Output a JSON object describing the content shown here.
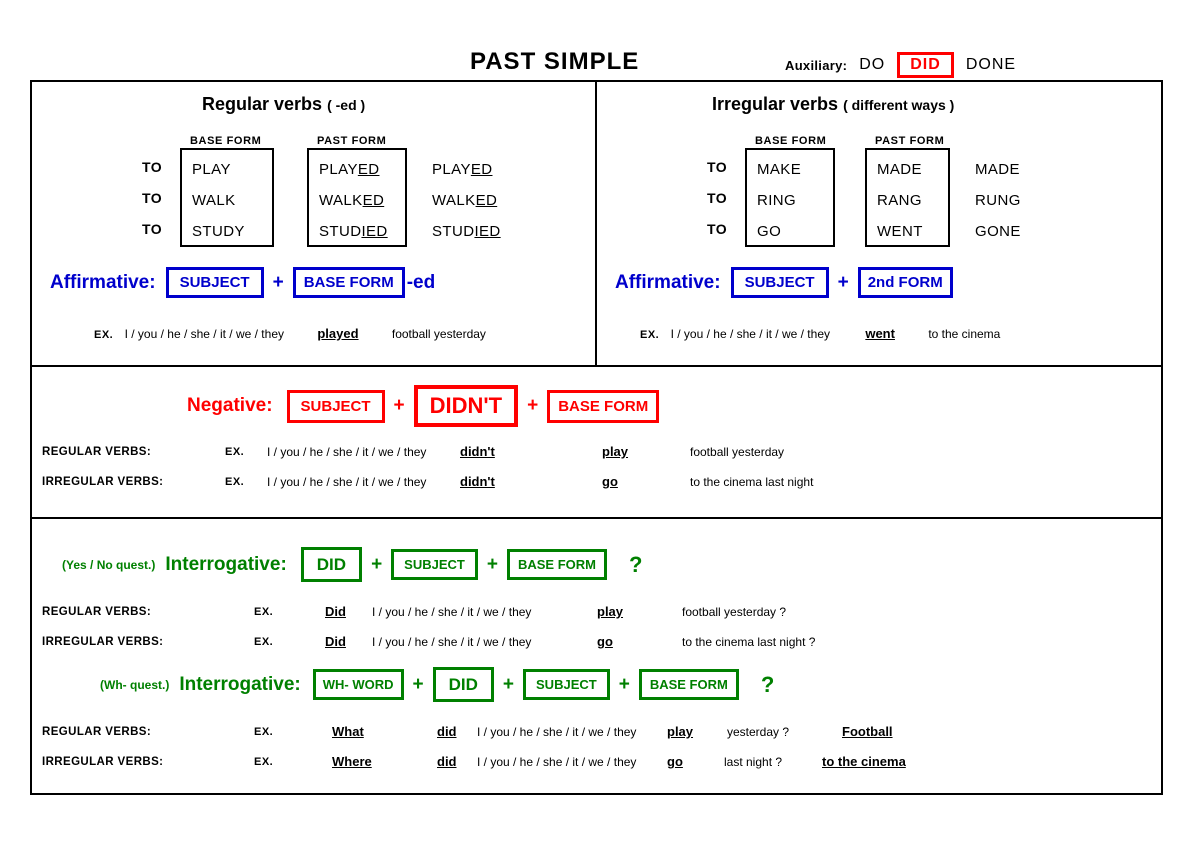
{
  "header": {
    "title": "PAST SIMPLE",
    "auxiliary_label": "Auxiliary:",
    "auxiliary_forms": [
      "DO",
      "DID",
      "DONE"
    ],
    "auxiliary_highlighted": "DID",
    "highlight_color": "#ff0000"
  },
  "colors": {
    "affirmative": "#0000cc",
    "negative": "#ff0000",
    "interrogative": "#008000",
    "text": "#000000"
  },
  "regular": {
    "title": "Regular verbs",
    "title_note": "( -ed )",
    "col_base": "BASE FORM",
    "col_past": "PAST FORM",
    "to_label": "TO",
    "rows": [
      {
        "base": "PLAY",
        "past_stem": "PLAY",
        "past_suffix": "ED",
        "third_stem": "PLAY",
        "third_suffix": "ED"
      },
      {
        "base": "WALK",
        "past_stem": "WALK",
        "past_suffix": "ED",
        "third_stem": "WALK",
        "third_suffix": "ED"
      },
      {
        "base": "STUDY",
        "past_stem": "STUD",
        "past_suffix": "IED",
        "third_stem": "STUD",
        "third_suffix": "IED"
      }
    ],
    "affirmative": {
      "label": "Affirmative:",
      "box1": "SUBJECT",
      "plus": "+",
      "box2": "BASE FORM",
      "suffix": "-ed",
      "ex_tag": "EX.",
      "ex_pron": "I / you / he / she / it / we / they",
      "ex_verb": "played",
      "ex_rest": "football yesterday"
    }
  },
  "irregular": {
    "title": "Irregular verbs",
    "title_note": "( different ways )",
    "col_base": "BASE FORM",
    "col_past": "PAST FORM",
    "to_label": "TO",
    "rows": [
      {
        "base": "MAKE",
        "past": "MADE",
        "third": "MADE"
      },
      {
        "base": "RING",
        "past": "RANG",
        "third": "RUNG"
      },
      {
        "base": "GO",
        "past": "WENT",
        "third": "GONE"
      }
    ],
    "affirmative": {
      "label": "Affirmative:",
      "box1": "SUBJECT",
      "plus": "+",
      "box2": "2nd FORM",
      "ex_tag": "EX.",
      "ex_pron": "I / you / he / she / it / we / they",
      "ex_verb": "went",
      "ex_rest": "to the cinema"
    }
  },
  "negative": {
    "label": "Negative:",
    "box1": "SUBJECT",
    "plus1": "+",
    "box2": "DIDN'T",
    "plus2": "+",
    "box3": "BASE FORM",
    "rows": [
      {
        "kind": "REGULAR VERBS:",
        "ex_tag": "EX.",
        "pron": "I / you / he / she / it / we / they",
        "aux": "didn't",
        "verb": "play",
        "rest": "football yesterday"
      },
      {
        "kind": "IRREGULAR VERBS:",
        "ex_tag": "EX.",
        "pron": "I / you / he / she / it / we / they",
        "aux": "didn't",
        "verb": "go",
        "rest": "to the cinema last night"
      }
    ]
  },
  "interrogative_yesno": {
    "note": "(Yes / No quest.)",
    "label": "Interrogative:",
    "box1": "DID",
    "plus1": "+",
    "box2": "SUBJECT",
    "plus2": "+",
    "box3": "BASE FORM",
    "qmark": "?",
    "rows": [
      {
        "kind": "REGULAR VERBS:",
        "ex_tag": "EX.",
        "aux": "Did",
        "pron": "I / you / he / she / it / we / they",
        "verb": "play",
        "rest": "football yesterday  ?"
      },
      {
        "kind": "IRREGULAR VERBS:",
        "ex_tag": "EX.",
        "aux": "Did",
        "pron": "I / you / he / she / it / we / they",
        "verb": "go",
        "rest": "to the cinema last night  ?"
      }
    ]
  },
  "interrogative_wh": {
    "note": "(Wh- quest.)",
    "label": "Interrogative:",
    "box1": "WH- WORD",
    "plus1": "+",
    "box2": "DID",
    "plus2": "+",
    "box3": "SUBJECT",
    "plus3": "+",
    "box4": "BASE FORM",
    "qmark": "?",
    "rows": [
      {
        "kind": "REGULAR VERBS:",
        "ex_tag": "EX.",
        "wh": "What",
        "aux": "did",
        "pron": "I / you / he / she / it / we / they",
        "verb": "play",
        "rest": "yesterday  ?",
        "answer": "Football"
      },
      {
        "kind": "IRREGULAR VERBS:",
        "ex_tag": "EX.",
        "wh": "Where",
        "aux": "did",
        "pron": "I / you / he / she / it / we / they",
        "verb": "go",
        "rest": "last night  ?",
        "answer": "to the cinema"
      }
    ]
  }
}
